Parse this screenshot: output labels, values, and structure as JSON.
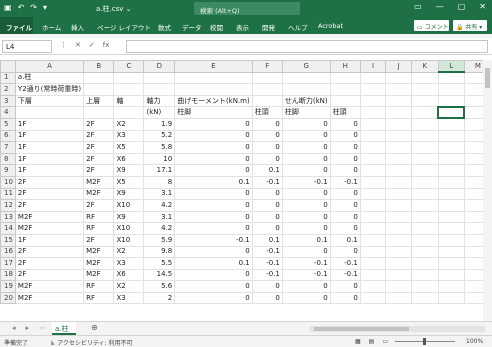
{
  "titlebar": {
    "icons": [
      "▣",
      "↶",
      "↷",
      "▾"
    ],
    "title": "a.柱.csv ⌄",
    "search_placeholder": "検索 (Alt+Q)",
    "window_buttons": [
      "▭",
      "—",
      "▢",
      "✕"
    ]
  },
  "ribbon": {
    "tabs": [
      "ファイル",
      "ホーム",
      "挿入",
      "ページ レイアウト",
      "数式",
      "データ",
      "校閲",
      "表示",
      "開発",
      "ヘルプ",
      "Acrobat"
    ],
    "comment_label": "▭ コメント",
    "share_label": "🔒 共有 ▾"
  },
  "formula_bar": {
    "name_box": "L4",
    "icons": [
      "⋮",
      "✕",
      "✓",
      "fx"
    ],
    "value": ""
  },
  "columns": [
    "A",
    "B",
    "C",
    "D",
    "E",
    "F",
    "G",
    "H",
    "I",
    "J",
    "K",
    "L",
    "M"
  ],
  "rows": [
    [
      "a.柱",
      "",
      "",
      "",
      "",
      "",
      "",
      "",
      "",
      "",
      "",
      "",
      ""
    ],
    [
      "Y2通り(常時荷重時)",
      "",
      "",
      "",
      "",
      "",
      "",
      "",
      "",
      "",
      "",
      "",
      ""
    ],
    [
      "下層",
      "上層",
      "軸",
      "軸力",
      "曲げモーメント(kN.m)",
      "",
      "せん断力(kN)",
      "",
      "",
      "",
      "",
      "",
      ""
    ],
    [
      "",
      "",
      "",
      "(kN)",
      "柱脚",
      "柱頭",
      "柱脚",
      "柱頭",
      "",
      "",
      "",
      "",
      ""
    ],
    [
      "1F",
      "2F",
      "X2",
      "1.9",
      "0",
      "0",
      "0",
      "0",
      "",
      "",
      "",
      "",
      ""
    ],
    [
      "1F",
      "2F",
      "X3",
      "5.2",
      "0",
      "0",
      "0",
      "0",
      "",
      "",
      "",
      "",
      ""
    ],
    [
      "1F",
      "2F",
      "X5",
      "5.8",
      "0",
      "0",
      "0",
      "0",
      "",
      "",
      "",
      "",
      ""
    ],
    [
      "1F",
      "2F",
      "X6",
      "10",
      "0",
      "0",
      "0",
      "0",
      "",
      "",
      "",
      "",
      ""
    ],
    [
      "1F",
      "2F",
      "X9",
      "17.1",
      "0",
      "0.1",
      "0",
      "0",
      "",
      "",
      "",
      "",
      ""
    ],
    [
      "2F",
      "M2F",
      "X5",
      "8",
      "0.1",
      "-0.1",
      "-0.1",
      "-0.1",
      "",
      "",
      "",
      "",
      ""
    ],
    [
      "2F",
      "M2F",
      "X9",
      "3.1",
      "0",
      "0",
      "0",
      "0",
      "",
      "",
      "",
      "",
      ""
    ],
    [
      "2F",
      "2F",
      "X10",
      "4.2",
      "0",
      "0",
      "0",
      "0",
      "",
      "",
      "",
      "",
      ""
    ],
    [
      "M2F",
      "RF",
      "X9",
      "3.1",
      "0",
      "0",
      "0",
      "0",
      "",
      "",
      "",
      "",
      ""
    ],
    [
      "M2F",
      "RF",
      "X10",
      "4.2",
      "0",
      "0",
      "0",
      "0",
      "",
      "",
      "",
      "",
      ""
    ],
    [
      "1F",
      "2F",
      "X10",
      "5.9",
      "-0.1",
      "0.1",
      "0.1",
      "0.1",
      "",
      "",
      "",
      "",
      ""
    ],
    [
      "2F",
      "M2F",
      "X2",
      "9.8",
      "0",
      "-0.1",
      "0",
      "0",
      "",
      "",
      "",
      "",
      ""
    ],
    [
      "2F",
      "M2F",
      "X3",
      "5.5",
      "0.1",
      "-0.1",
      "-0.1",
      "-0.1",
      "",
      "",
      "",
      "",
      ""
    ],
    [
      "2F",
      "M2F",
      "X6",
      "14.5",
      "0",
      "-0.1",
      "-0.1",
      "-0.1",
      "",
      "",
      "",
      "",
      ""
    ],
    [
      "M2F",
      "RF",
      "X2",
      "5.6",
      "0",
      "0",
      "0",
      "0",
      "",
      "",
      "",
      "",
      ""
    ],
    [
      "M2F",
      "RF",
      "X3",
      "2",
      "0",
      "0",
      "0",
      "0",
      "",
      "",
      "",
      "",
      ""
    ]
  ],
  "sheetbar": {
    "nav": [
      "◂",
      "▸",
      "⋯"
    ],
    "tab": "a.柱",
    "add": "⊕"
  },
  "statusbar": {
    "ready": "準備完了",
    "accessibility": "♿ アクセシビリティ: 利用不可",
    "view_icons": [
      "▦",
      "▤",
      "▭"
    ],
    "zoom": "100%"
  },
  "accent": "#1e7145"
}
